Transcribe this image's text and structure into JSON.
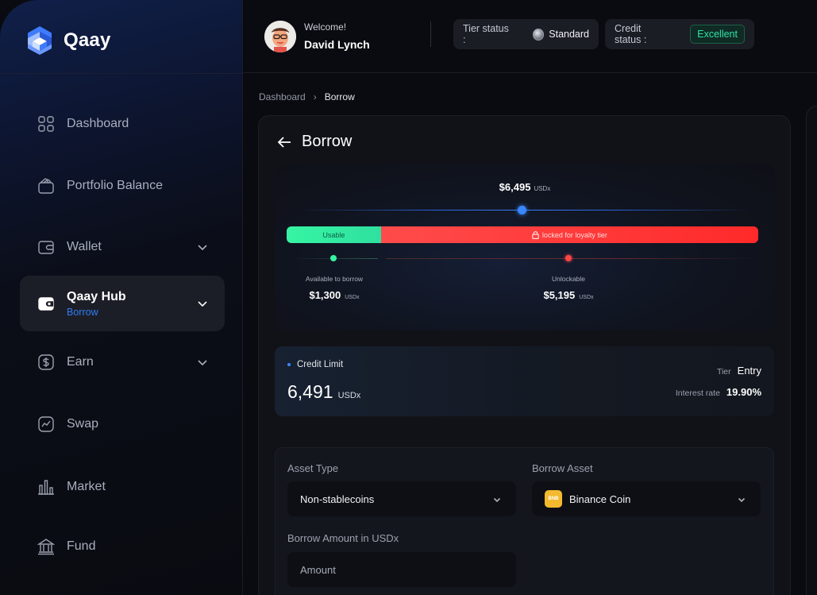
{
  "app": {
    "name": "Qaay"
  },
  "sidebar": {
    "items": [
      {
        "label": "Dashboard",
        "icon": "grid-icon"
      },
      {
        "label": "Portfolio Balance",
        "icon": "wallet-open-icon"
      },
      {
        "label": "Wallet",
        "icon": "wallet-icon"
      },
      {
        "label": "Qaay Hub",
        "sub": "Borrow",
        "icon": "wallet-icon"
      },
      {
        "label": "Earn",
        "icon": "dollar-icon"
      },
      {
        "label": "Swap",
        "icon": "chart-line-icon"
      },
      {
        "label": "Market",
        "icon": "bar-chart-icon"
      },
      {
        "label": "Fund",
        "icon": "bank-icon"
      }
    ]
  },
  "header": {
    "welcome": "Welcome!",
    "user_name": "David Lynch",
    "tier_label": "Tier status :",
    "tier_value": "Standard",
    "credit_label": "Credit status :",
    "credit_value": "Excellent"
  },
  "breadcrumb": {
    "parent": "Dashboard",
    "current": "Borrow"
  },
  "borrow": {
    "title": "Borrow",
    "total_amount": "$6,495",
    "total_unit": "USDx",
    "usable_label": "Usable",
    "usable_fraction": 0.2,
    "locked_label": "locked for loyalty tier",
    "available_label": "Available to borrow",
    "available_value": "$1,300",
    "available_unit": "USDx",
    "unlockable_label": "Unlockable",
    "unlockable_value": "$5,195",
    "unlockable_unit": "USDx"
  },
  "credit": {
    "label": "Credit Limit",
    "value": "6,491",
    "unit": "USDx",
    "tier_label": "Tier",
    "tier_value": "Entry",
    "rate_label": "Interest rate",
    "rate_value": "19.90%"
  },
  "form": {
    "asset_type_label": "Asset Type",
    "asset_type_value": "Non-stablecoins",
    "borrow_asset_label": "Borrow Asset",
    "borrow_asset_value": "Binance Coin",
    "borrow_asset_icon_text": "BNB",
    "amount_label": "Borrow Amount in USDx",
    "amount_placeholder": "Amount"
  },
  "colors": {
    "accent_blue": "#3a86ff",
    "usable_green": "#36f5a3",
    "locked_red": "#ff3a3a",
    "excellent_green": "#2ee3a8",
    "bnb_yellow": "#f3ba2f"
  }
}
